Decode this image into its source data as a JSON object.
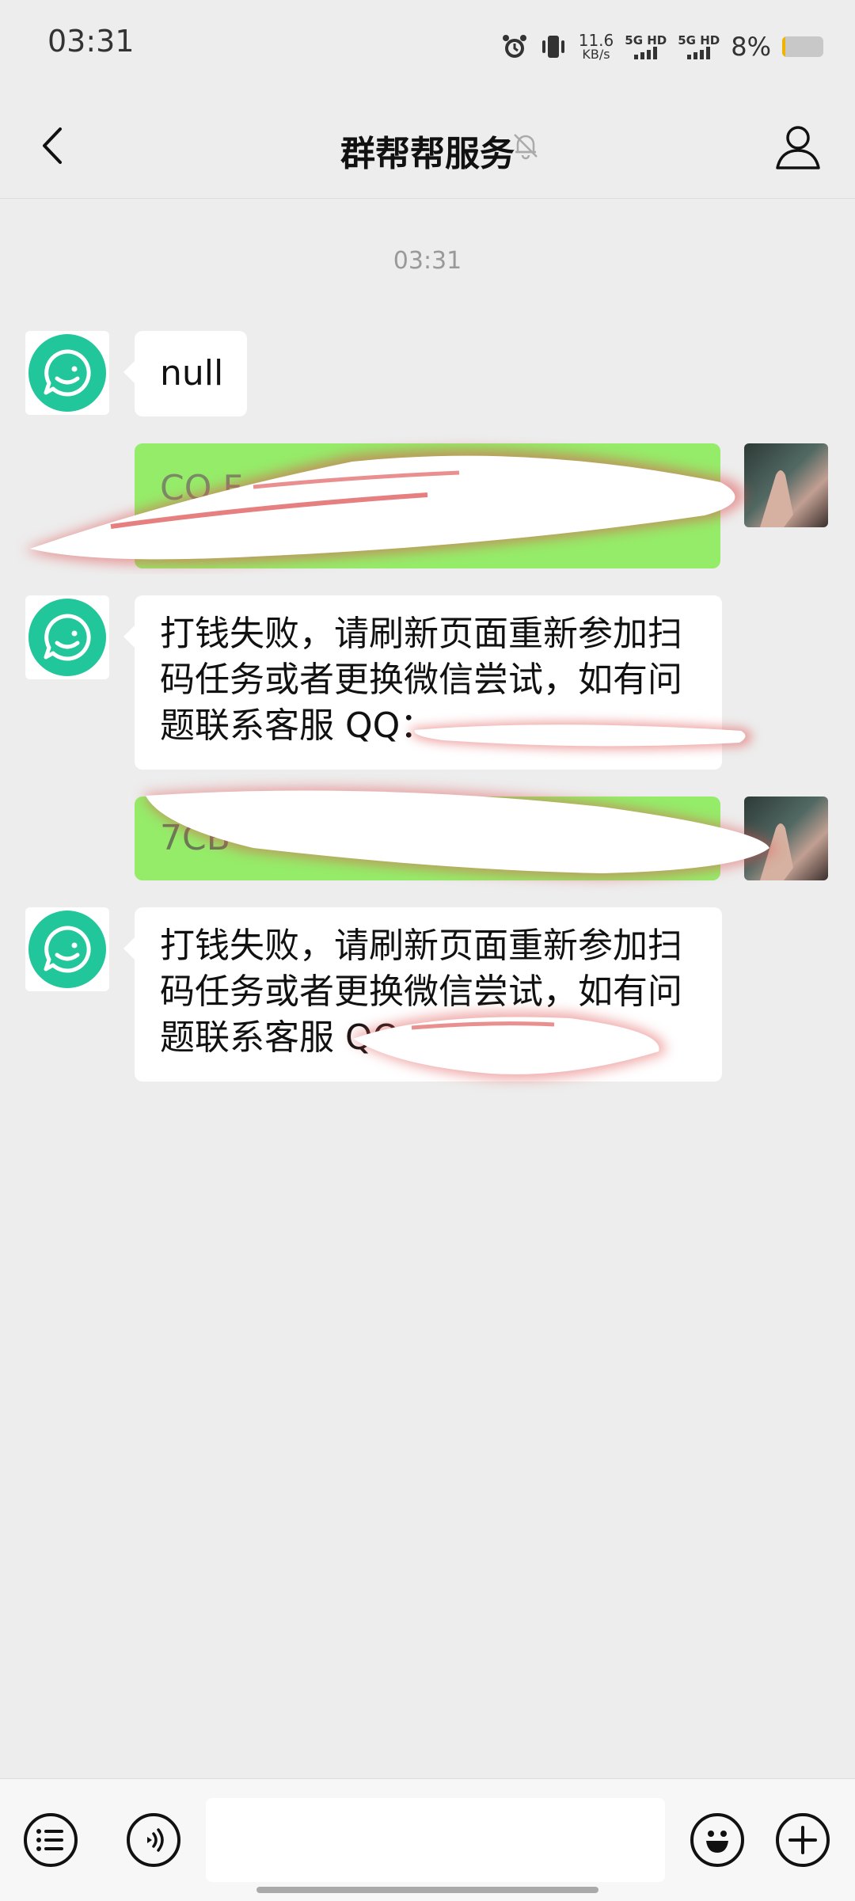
{
  "status_bar": {
    "time": "03:31",
    "net_speed_value": "11.6",
    "net_speed_unit": "KB/s",
    "sim1_label": "5G HD",
    "sim2_label": "5G HD",
    "battery_percent": "8%",
    "battery_level": 0.08,
    "battery_color": "#f0b400",
    "icons": [
      "alarm-icon",
      "vibrate-icon",
      "signal-icon",
      "battery-icon"
    ]
  },
  "header": {
    "title": "群帮帮服务",
    "back_icon": "chevron-left-icon",
    "mute_icon": "bell-off-icon",
    "profile_icon": "person-icon"
  },
  "chat": {
    "timestamp": "03:31",
    "messages": [
      {
        "side": "left",
        "text": "null"
      },
      {
        "side": "right",
        "text": "CO F",
        "redacted": true
      },
      {
        "side": "left",
        "text": "打钱失败，请刷新页面重新参加扫码任务或者更换微信尝试，如有问题联系客服 QQ：",
        "redacted_tail": true
      },
      {
        "side": "right",
        "text": "7CB",
        "redacted": true
      },
      {
        "side": "left",
        "text": "打钱失败，请刷新页面重新参加扫码任务或者更换微信尝试，如有问题联系客服 QQ",
        "redacted_tail": true
      }
    ]
  },
  "input_bar": {
    "placeholder": "",
    "icons": [
      "menu-list-icon",
      "voice-icon",
      "emoji-icon",
      "plus-icon"
    ]
  },
  "colors": {
    "background": "#ededed",
    "bot_avatar": "#21c69b",
    "sent_bubble": "#95ec69",
    "received_bubble": "#ffffff",
    "redaction_glow": "#e05050"
  }
}
